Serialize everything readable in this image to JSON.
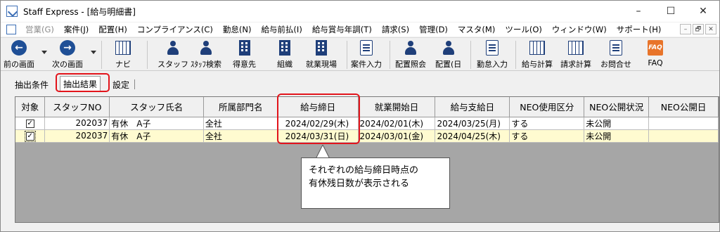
{
  "window": {
    "title": "Staff Express - [給与明細書]",
    "controls": [
      "–",
      "☐",
      "✕"
    ]
  },
  "menu": {
    "items": [
      {
        "label": "営業(G)",
        "disabled": true
      },
      {
        "label": "案件(J)",
        "disabled": false
      },
      {
        "label": "配置(H)",
        "disabled": false
      },
      {
        "label": "コンプライアンス(C)",
        "disabled": false
      },
      {
        "label": "勤怠(N)",
        "disabled": false
      },
      {
        "label": "給与前払(I)",
        "disabled": false
      },
      {
        "label": "給与賞与年調(T)",
        "disabled": false
      },
      {
        "label": "請求(S)",
        "disabled": false
      },
      {
        "label": "管理(D)",
        "disabled": false
      },
      {
        "label": "マスタ(M)",
        "disabled": false
      },
      {
        "label": "ツール(O)",
        "disabled": false
      },
      {
        "label": "ウィンドウ(W)",
        "disabled": false
      },
      {
        "label": "サポート(H)",
        "disabled": false
      }
    ],
    "mdi_controls": [
      "–",
      "🗗",
      "✕"
    ]
  },
  "toolbar": {
    "back": "前の画面",
    "forward": "次の画面",
    "navi": "ナビ",
    "staff": "スタッフ",
    "staff_search": "ｽﾀｯﾌ検索",
    "client": "得意先",
    "org": "組織",
    "site": "就業現場",
    "case_input": "案件入力",
    "assign_inquiry": "配置照会",
    "assign_day": "配置(日",
    "attendance_input": "勤怠入力",
    "payroll_calc": "給与計算",
    "billing_calc": "請求計算",
    "inquiry": "お問合せ",
    "faq": "FAQ",
    "faq_icon_text": "FAQ"
  },
  "tabs": {
    "conditions": "抽出条件",
    "results": "抽出結果",
    "settings": "設定"
  },
  "grid": {
    "headers": [
      "対象",
      "スタッフNO",
      "スタッフ氏名",
      "所属部門名",
      "給与締日",
      "就業開始日",
      "給与支給日",
      "NEO使用区分",
      "NEO公開状況",
      "NEO公開日"
    ],
    "rows": [
      {
        "checked": "✓",
        "staff_no": "202037",
        "name": "有休　A子",
        "dept": "全社",
        "closing": "2024/02/29(木)",
        "start": "2024/02/01(木)",
        "pay": "2024/03/25(月)",
        "neo_use": "する",
        "neo_status": "未公開",
        "neo_date": ""
      },
      {
        "checked": "✓",
        "staff_no": "202037",
        "name": "有休　A子",
        "dept": "全社",
        "closing": "2024/03/31(日)",
        "start": "2024/03/01(金)",
        "pay": "2024/04/25(木)",
        "neo_use": "する",
        "neo_status": "未公開",
        "neo_date": ""
      }
    ]
  },
  "callout": {
    "line1": "それぞれの給与締日時点の",
    "line2": "有休残日数が表示される"
  },
  "colors": {
    "accent_red": "#e2141b",
    "selected_row": "#fffbd0",
    "icon_blue": "#1f3f7a"
  }
}
